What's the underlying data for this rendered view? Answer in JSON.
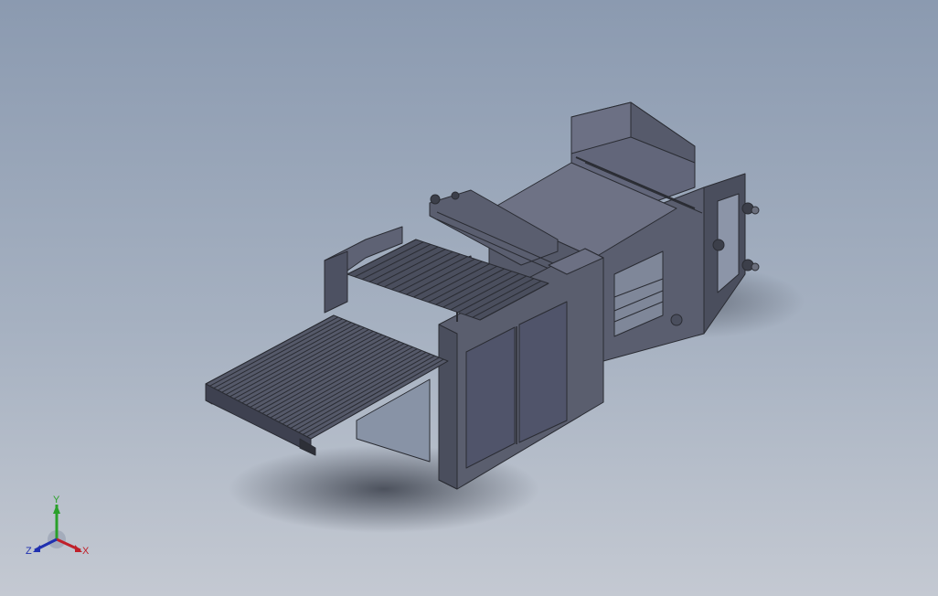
{
  "viewport": {
    "background_top": "#8b9ab0",
    "background_bottom": "#c4c9d2",
    "model_fill": "#5d6170",
    "model_edge": "#2a2c33"
  },
  "triad": {
    "x_label": "X",
    "y_label": "Y",
    "z_label": "Z",
    "x_color": "#c0202a",
    "y_color": "#2aa02a",
    "z_color": "#2030b0"
  }
}
